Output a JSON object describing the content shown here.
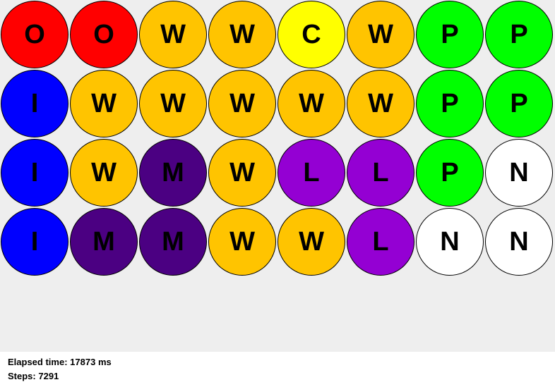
{
  "colors": {
    "O": "#ff0000",
    "W": "#ffc400",
    "C": "#ffff00",
    "P": "#00ff00",
    "I": "#0000ff",
    "M": "#4b0082",
    "L": "#9400d3",
    "N": "#ffffff"
  },
  "board": {
    "rows": [
      [
        "O",
        "O",
        "W",
        "W",
        "C",
        "W",
        "P",
        "P"
      ],
      [
        "I",
        "W",
        "W",
        "W",
        "W",
        "W",
        "P",
        "P"
      ],
      [
        "I",
        "W",
        "M",
        "W",
        "L",
        "L",
        "P",
        "N"
      ],
      [
        "I",
        "M",
        "M",
        "W",
        "W",
        "L",
        "N",
        "N"
      ]
    ]
  },
  "status": {
    "elapsed_label": "Elapsed time:",
    "elapsed_value": "17873",
    "elapsed_unit": "ms",
    "steps_label": "Steps:",
    "steps_value": "7291"
  }
}
